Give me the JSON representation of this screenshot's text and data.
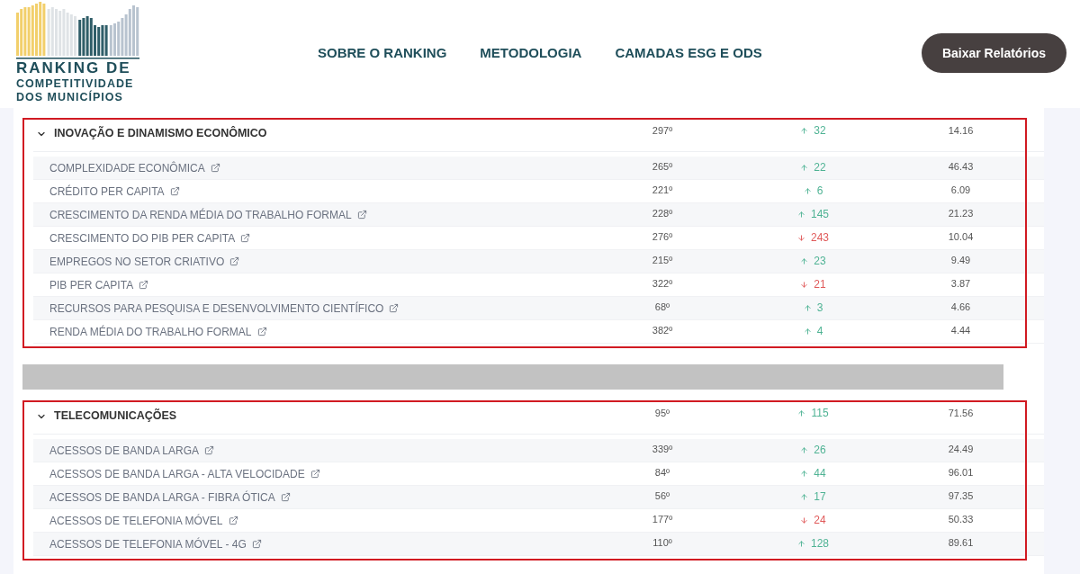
{
  "logo": {
    "lines": [
      "RANKING DE",
      "COMPETITIVIDADE",
      "DOS MUNICÍPIOS"
    ]
  },
  "nav": [
    "SOBRE O RANKING",
    "METODOLOGIA",
    "CAMADAS ESG E ODS"
  ],
  "download_button": "Baixar Relatórios",
  "sections": [
    {
      "title": "INOVAÇÃO E DINAMISMO ECONÔMICO",
      "expanded": true,
      "highlighted": true,
      "position": "297º",
      "delta": "32",
      "kind": "up",
      "score": "14.16",
      "rows": [
        {
          "name": "COMPLEXIDADE ECONÔMICA",
          "position": "265º",
          "delta": "22",
          "kind": "up",
          "score": "46.43"
        },
        {
          "name": "CRÉDITO PER CAPITA",
          "position": "221º",
          "delta": "6",
          "kind": "up",
          "score": "6.09"
        },
        {
          "name": "CRESCIMENTO DA RENDA MÉDIA DO TRABALHO FORMAL",
          "position": "228º",
          "delta": "145",
          "kind": "up",
          "score": "21.23"
        },
        {
          "name": "CRESCIMENTO DO PIB PER CAPITA",
          "position": "276º",
          "delta": "243",
          "kind": "down",
          "score": "10.04"
        },
        {
          "name": "EMPREGOS NO SETOR CRIATIVO",
          "position": "215º",
          "delta": "23",
          "kind": "up",
          "score": "9.49"
        },
        {
          "name": "PIB PER CAPITA",
          "position": "322º",
          "delta": "21",
          "kind": "down",
          "score": "3.87"
        },
        {
          "name": "RECURSOS PARA PESQUISA E DESENVOLVIMENTO CIENTÍFICO",
          "position": "68º",
          "delta": "3",
          "kind": "up",
          "score": "4.66"
        },
        {
          "name": "RENDA MÉDIA DO TRABALHO FORMAL",
          "position": "382º",
          "delta": "4",
          "kind": "up",
          "score": "4.44"
        }
      ]
    },
    {
      "title": "TELECOMUNICAÇÕES",
      "expanded": true,
      "highlighted": true,
      "position": "95º",
      "delta": "115",
      "kind": "up",
      "score": "71.56",
      "rows": [
        {
          "name": "ACESSOS DE BANDA LARGA",
          "position": "339º",
          "delta": "26",
          "kind": "up",
          "score": "24.49"
        },
        {
          "name": "ACESSOS DE BANDA LARGA - ALTA VELOCIDADE",
          "position": "84º",
          "delta": "44",
          "kind": "up",
          "score": "96.01"
        },
        {
          "name": "ACESSOS DE BANDA LARGA - FIBRA ÓTICA",
          "position": "56º",
          "delta": "17",
          "kind": "up",
          "score": "97.35"
        },
        {
          "name": "ACESSOS DE TELEFONIA MÓVEL",
          "position": "177º",
          "delta": "24",
          "kind": "down",
          "score": "50.33"
        },
        {
          "name": "ACESSOS DE TELEFONIA MÓVEL - 4G",
          "position": "110º",
          "delta": "128",
          "kind": "up",
          "score": "89.61"
        }
      ]
    }
  ]
}
